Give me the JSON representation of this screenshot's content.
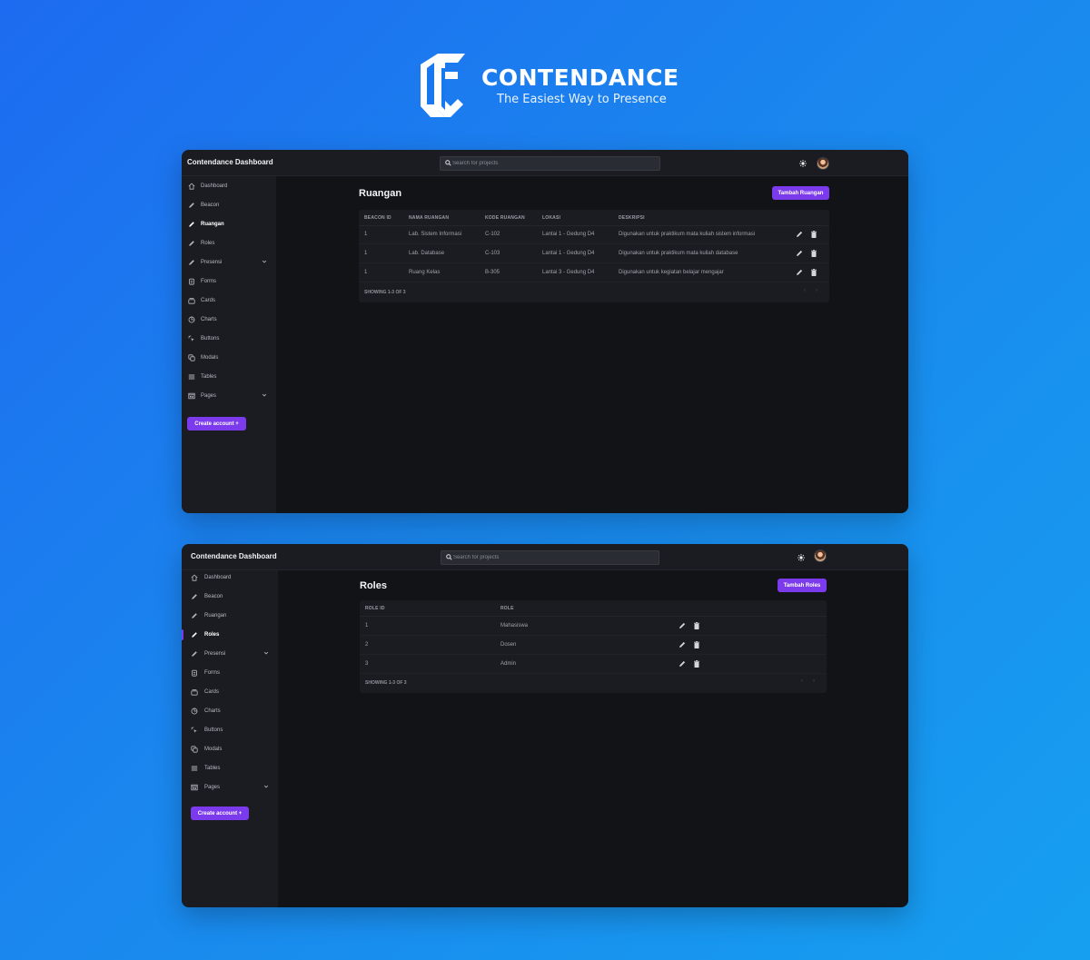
{
  "brand": {
    "name": "CONTENDANCE",
    "tagline": "The Easiest Way to Presence",
    "color": "#ffffff"
  },
  "colors": {
    "accent": "#7c3aed",
    "window_bg": "#121317",
    "panel_bg": "#1b1c22",
    "background_gradient": [
      "#1d6bf0",
      "#169ff0"
    ]
  },
  "windows": [
    {
      "app_title": "Contendance Dashboard",
      "search_placeholder": "Search for projects",
      "theme_icon": "sun-icon",
      "nav": [
        {
          "label": "Dashboard",
          "icon": "home-icon"
        },
        {
          "label": "Beacon",
          "icon": "pencil-icon"
        },
        {
          "label": "Ruangan",
          "icon": "pencil-icon",
          "active": true
        },
        {
          "label": "Roles",
          "icon": "pencil-icon"
        },
        {
          "label": "Presensi",
          "icon": "pencil-icon",
          "has_submenu": true
        },
        {
          "label": "Forms",
          "icon": "clipboard-icon"
        },
        {
          "label": "Cards",
          "icon": "cards-icon"
        },
        {
          "label": "Charts",
          "icon": "pie-chart-icon"
        },
        {
          "label": "Buttons",
          "icon": "cursor-click-icon"
        },
        {
          "label": "Modals",
          "icon": "duplicate-icon"
        },
        {
          "label": "Tables",
          "icon": "table-icon"
        },
        {
          "label": "Pages",
          "icon": "pages-icon",
          "has_submenu": true
        }
      ],
      "create_account_label": "Create account +",
      "page_title": "Ruangan",
      "add_button_label": "Tambah Ruangan",
      "table": {
        "columns": [
          "BEACON ID",
          "NAMA RUANGAN",
          "KODE RUANGAN",
          "LOKASI",
          "DESKRIPSI"
        ],
        "rows": [
          [
            "1",
            "Lab. Sistem Informasi",
            "C-102",
            "Lantai 1 - Gedung D4",
            "Digunakan untuk praktikum mata kuliah sistem informasi"
          ],
          [
            "1",
            "Lab. Database",
            "C-103",
            "Lantai 1 - Gedung D4",
            "Digunakan untuk praktikum mata kuliah database"
          ],
          [
            "1",
            "Ruang Kelas",
            "B-305",
            "Lantai 3 - Gedung D4",
            "Digunakan untuk kegiatan belajar mengajar"
          ]
        ],
        "footer": "SHOWING 1-3 OF 3",
        "pager_prev": "‹",
        "pager_next": "›"
      }
    },
    {
      "app_title": "Contendance Dashboard",
      "search_placeholder": "Search for projects",
      "theme_icon": "sun-icon",
      "nav": [
        {
          "label": "Dashboard",
          "icon": "home-icon"
        },
        {
          "label": "Beacon",
          "icon": "pencil-icon"
        },
        {
          "label": "Ruangan",
          "icon": "pencil-icon"
        },
        {
          "label": "Roles",
          "icon": "pencil-icon",
          "active": true
        },
        {
          "label": "Presensi",
          "icon": "pencil-icon",
          "has_submenu": true
        },
        {
          "label": "Forms",
          "icon": "clipboard-icon"
        },
        {
          "label": "Cards",
          "icon": "cards-icon"
        },
        {
          "label": "Charts",
          "icon": "pie-chart-icon"
        },
        {
          "label": "Buttons",
          "icon": "cursor-click-icon"
        },
        {
          "label": "Modals",
          "icon": "duplicate-icon"
        },
        {
          "label": "Tables",
          "icon": "table-icon"
        },
        {
          "label": "Pages",
          "icon": "pages-icon",
          "has_submenu": true
        }
      ],
      "create_account_label": "Create account +",
      "page_title": "Roles",
      "add_button_label": "Tambah Roles",
      "table": {
        "columns": [
          "ROLE ID",
          "ROLE"
        ],
        "rows": [
          [
            "1",
            "Mahasiswa"
          ],
          [
            "2",
            "Dosen"
          ],
          [
            "3",
            "Admin"
          ]
        ],
        "footer": "SHOWING 1-3 OF 3",
        "pager_prev": "‹",
        "pager_next": "›"
      }
    }
  ]
}
